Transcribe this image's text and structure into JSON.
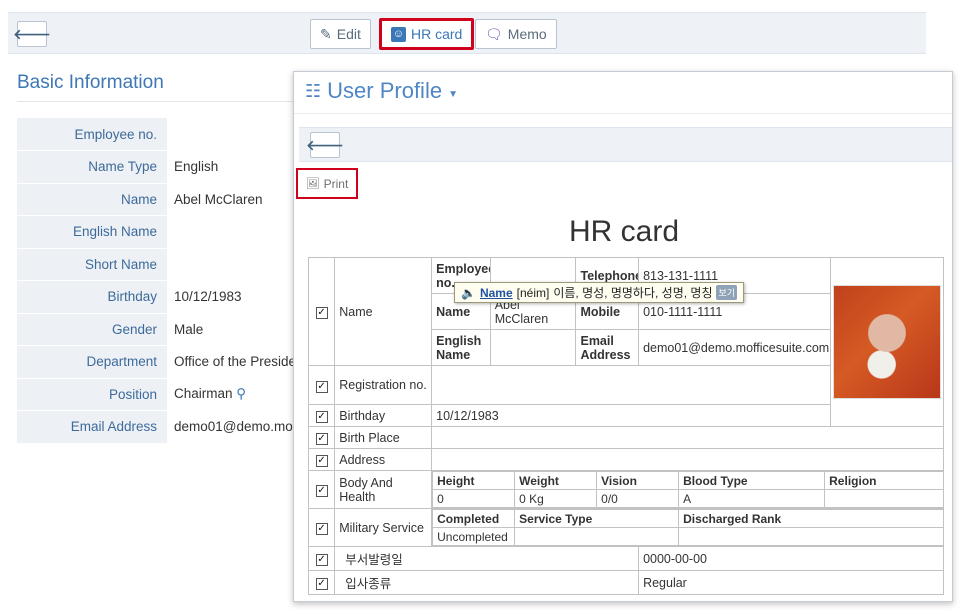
{
  "toolbar": {
    "back_icon": "arrow-left-icon",
    "edit_label": "Edit",
    "hrcard_label": "HR card",
    "memo_label": "Memo"
  },
  "basic": {
    "title": "Basic Information",
    "rows": [
      {
        "label": "Employee no.",
        "value": ""
      },
      {
        "label": "Name Type",
        "value": "English"
      },
      {
        "label": "Name",
        "value": "Abel McClaren"
      },
      {
        "label": "English Name",
        "value": ""
      },
      {
        "label": "Short Name",
        "value": ""
      },
      {
        "label": "Birthday",
        "value": "10/12/1983"
      },
      {
        "label": "Gender",
        "value": "Male"
      },
      {
        "label": "Department",
        "value": "Office of the Preside"
      },
      {
        "label": "Position",
        "value": "Chairman"
      },
      {
        "label": "Email Address",
        "value": "demo01@demo.mo"
      }
    ]
  },
  "popup": {
    "title": "User Profile",
    "print_label": "Print",
    "hr_title": "HR card",
    "name_label": "Name",
    "employee_no_label": "Employee no.",
    "name_sub_label": "Name",
    "name_value": "Abel McClaren",
    "english_name_label": "English Name",
    "telephone_label": "Telephone",
    "telephone_value": "813-131-1111",
    "mobile_label": "Mobile",
    "mobile_value": "010-1111-1111",
    "email_label": "Email Address",
    "email_value": "demo01@demo.mofficesuite.com",
    "registration_label": "Registration no.",
    "birthday_label": "Birthday",
    "birthday_value": "10/12/1983",
    "birthplace_label": "Birth Place",
    "address_label": "Address",
    "body_label": "Body And Health",
    "height_label": "Height",
    "height_value": "0",
    "weight_label": "Weight",
    "weight_value": "0 Kg",
    "vision_label": "Vision",
    "vision_value": "0/0",
    "blood_label": "Blood Type",
    "blood_value": "A",
    "religion_label": "Religion",
    "religion_value": "",
    "military_label": "Military Service",
    "completed_label": "Completed",
    "completed_value": "Uncompleted",
    "service_type_label": "Service Type",
    "discharged_label": "Discharged Rank",
    "dept_date_label": "부서발령일",
    "dept_date_value": "0000-00-00",
    "join_type_label": "입사종류",
    "join_type_value": "Regular"
  },
  "dict": {
    "word": "Name",
    "pron": "[néim]",
    "meaning": "이름, 명성, 명명하다, 성명, 명칭",
    "tag": "보기"
  }
}
